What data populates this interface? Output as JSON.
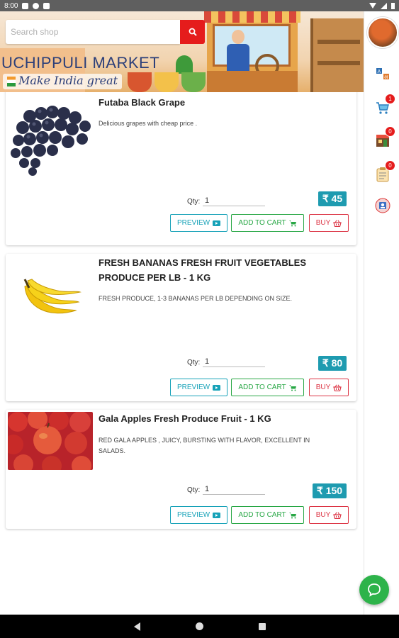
{
  "status_bar": {
    "time": "8:00"
  },
  "banner": {
    "brand": "UCHIPPULI MARKET",
    "tagline": "Make India great"
  },
  "search": {
    "placeholder": "Search shop"
  },
  "sidebar": {
    "cart_count": "1",
    "orders_count": "0",
    "notes_count": "0"
  },
  "products": [
    {
      "title": "Futaba Black Grape",
      "description": "Delicious grapes with cheap price .",
      "qty_label": "Qty:",
      "qty": "1",
      "price": "₹ 45",
      "preview": "PREVIEW",
      "add_to_cart": "ADD TO CART",
      "buy": "BUY"
    },
    {
      "title": "FRESH BANANAS FRESH FRUIT VEGETABLES PRODUCE PER LB - 1 KG",
      "description": "FRESH PRODUCE, 1-3 BANANAS PER LB DEPENDING ON SIZE.",
      "qty_label": "Qty:",
      "qty": "1",
      "price": "₹ 80",
      "preview": "PREVIEW",
      "add_to_cart": "ADD TO CART",
      "buy": "BUY"
    },
    {
      "title": "Gala Apples Fresh Produce Fruit - 1 KG",
      "description": "RED GALA APPLES , JUICY, BURSTING WITH FLAVOR, EXCELLENT IN SALADS.",
      "qty_label": "Qty:",
      "qty": "1",
      "price": "₹ 150",
      "preview": "PREVIEW",
      "add_to_cart": "ADD TO CART",
      "buy": "BUY"
    }
  ]
}
